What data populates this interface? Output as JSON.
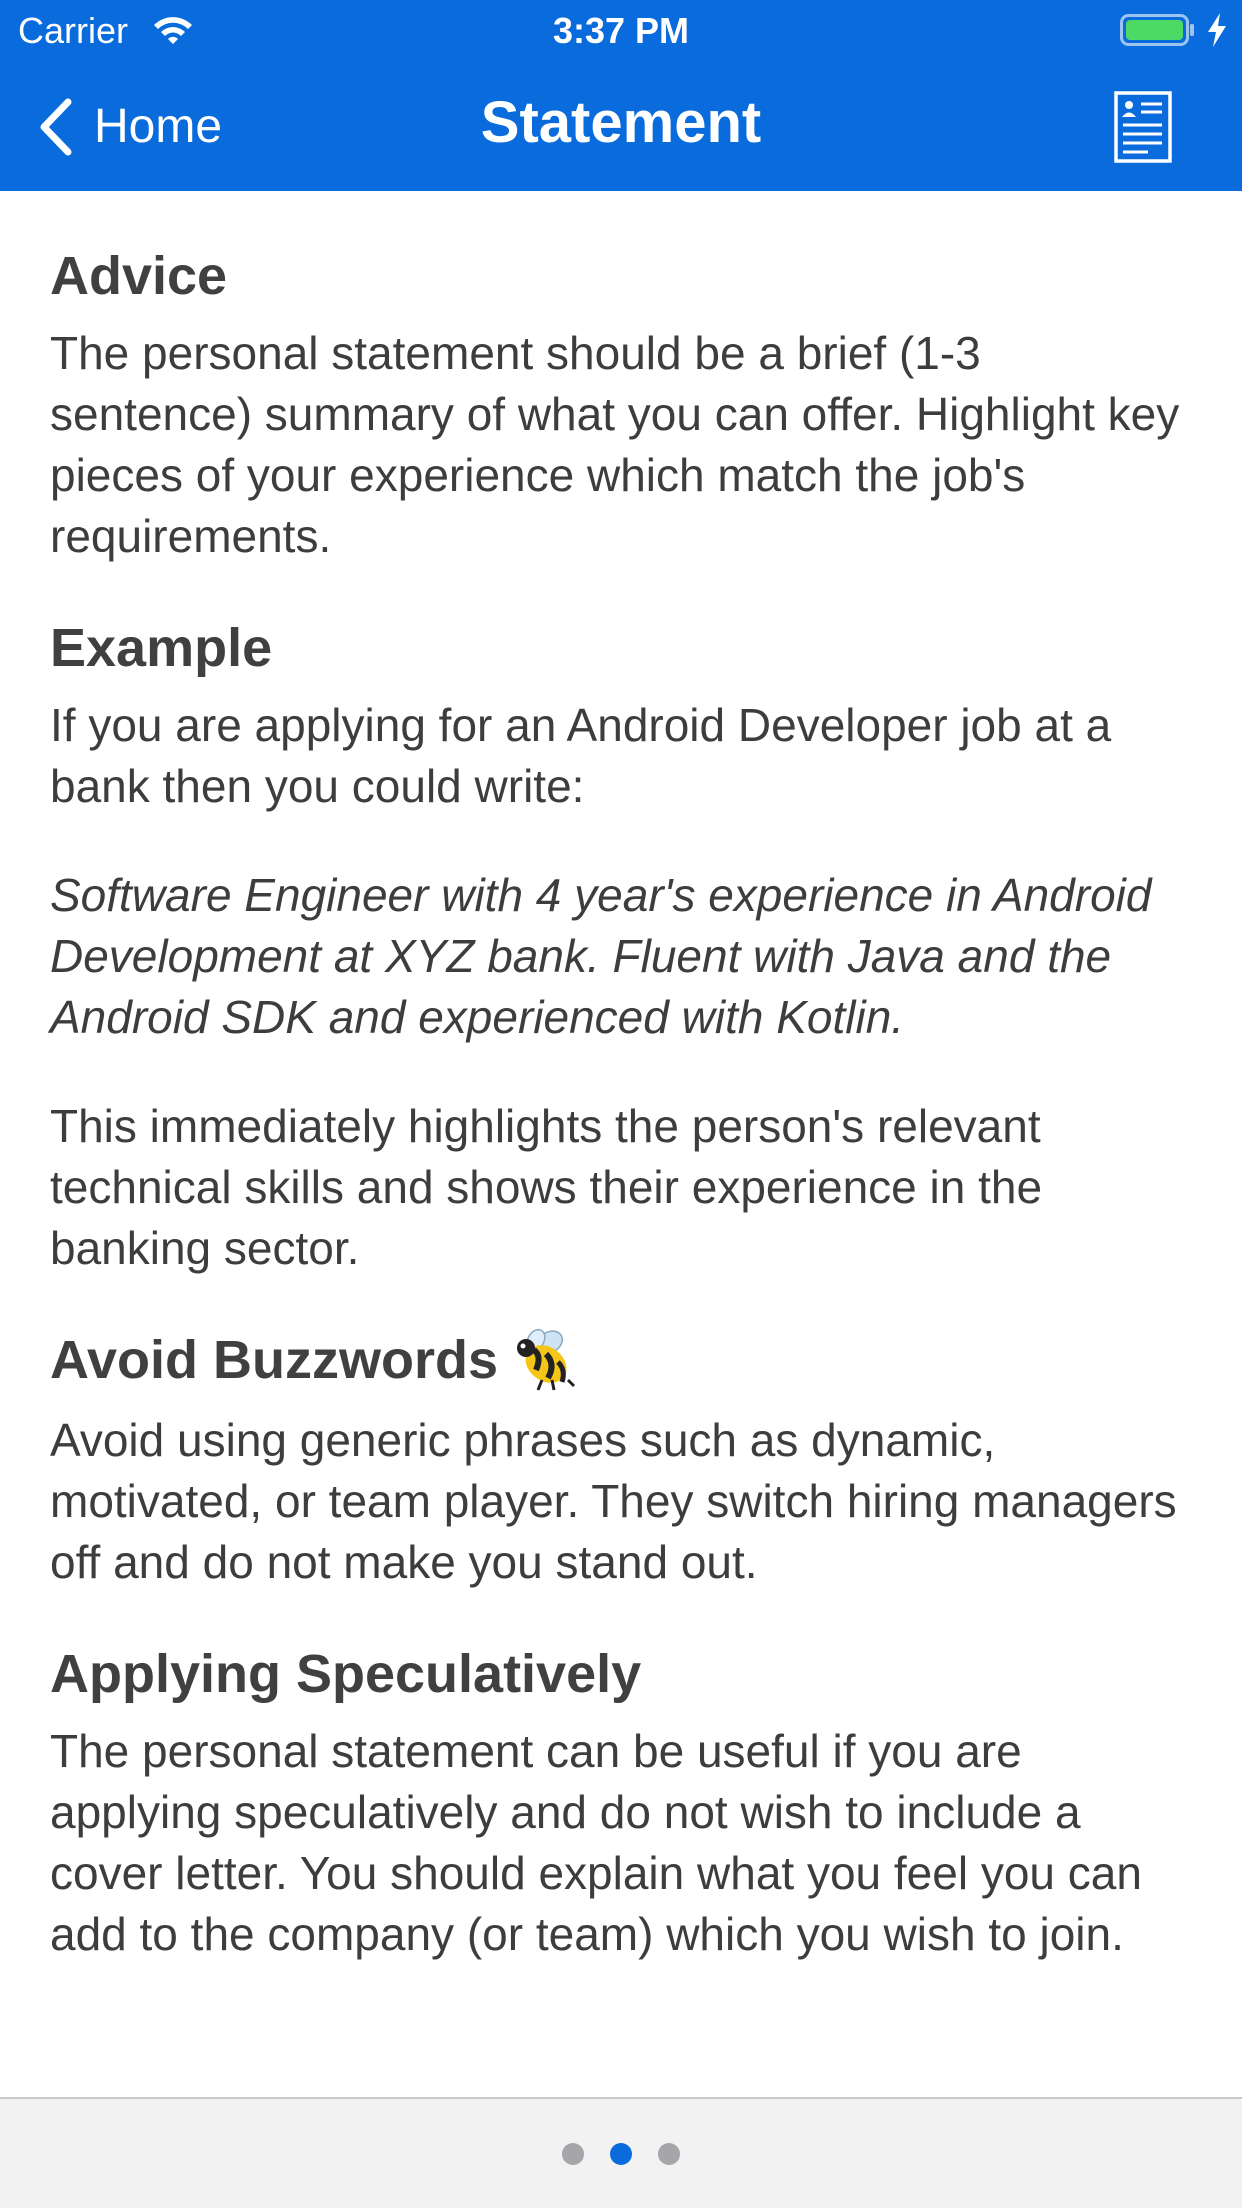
{
  "status_bar": {
    "carrier": "Carrier",
    "time": "3:37 PM",
    "wifi_icon": "wifi-icon",
    "battery_icon": "battery-icon",
    "battery_level": 1.0,
    "charging_icon": "charging-bolt-icon"
  },
  "nav": {
    "back_label": "Home",
    "back_icon": "chevron-left-icon",
    "title": "Statement",
    "right_icon": "document-icon",
    "background_color": "#0a6bdc"
  },
  "sections": {
    "advice": {
      "heading": "Advice",
      "text": "The personal statement should be a brief (1-3 sentence) summary of what you can offer. Highlight key pieces of your experience which match the job's requirements."
    },
    "example": {
      "heading": "Example",
      "intro": "If you are applying for an Android Developer job at a bank then you could write:",
      "quote": "Software Engineer with 4 year's experience in Android Development at XYZ bank. Fluent with Java and the Android SDK and experienced with Kotlin.",
      "explanation": "This immediately highlights the person's relevant technical skills and shows their experience in the banking sector."
    },
    "buzzwords": {
      "heading": "Avoid Buzzwords",
      "icon": "bee-icon",
      "text": "Avoid using generic phrases such as dynamic, motivated, or team player. They switch hiring managers off and do not make you stand out."
    },
    "speculative": {
      "heading": "Applying Speculatively",
      "text": "The personal statement can be useful if you are applying speculatively and do not wish to include a cover letter. You should explain what you feel you can add to the company (or team) which you wish to join."
    }
  },
  "page_control": {
    "page_count": 3,
    "current_page": 2,
    "active_color": "#0a6bdc",
    "inactive_color": "#a6a6aa"
  }
}
